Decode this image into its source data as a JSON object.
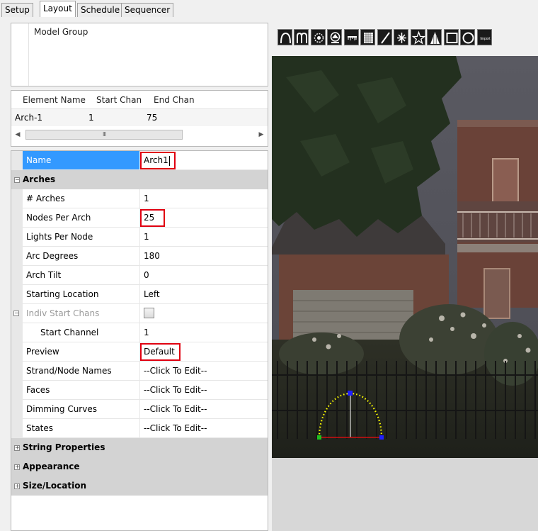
{
  "tabs": [
    {
      "label": "Setup",
      "active": false
    },
    {
      "label": "Layout",
      "active": true
    },
    {
      "label": "Schedule",
      "active": false
    },
    {
      "label": "Sequencer",
      "active": false
    }
  ],
  "model_group": {
    "header": "Model Group"
  },
  "elements": {
    "columns": [
      "Element Name",
      "Start Chan",
      "End Chan"
    ],
    "rows": [
      {
        "name": "Arch-1",
        "start": "1",
        "end": "75"
      }
    ],
    "scroll_grip": "III"
  },
  "properties": {
    "name": {
      "label": "Name",
      "value": "Arch1"
    },
    "arches_category": "Arches",
    "num_arches": {
      "label": "# Arches",
      "value": "1"
    },
    "nodes_per_arch": {
      "label": "Nodes Per Arch",
      "value": "25"
    },
    "lights_per_node": {
      "label": "Lights Per Node",
      "value": "1"
    },
    "arc_degrees": {
      "label": "Arc Degrees",
      "value": "180"
    },
    "arch_tilt": {
      "label": "Arch Tilt",
      "value": "0"
    },
    "starting_location": {
      "label": "Starting Location",
      "value": "Left"
    },
    "indiv_start_chans": {
      "label": "Indiv Start Chans",
      "checked": false
    },
    "start_channel": {
      "label": "Start Channel",
      "value": "1"
    },
    "preview": {
      "label": "Preview",
      "value": "Default"
    },
    "strand_node_names": {
      "label": "Strand/Node Names",
      "value": "--Click To Edit--"
    },
    "faces": {
      "label": "Faces",
      "value": "--Click To Edit--"
    },
    "dimming_curves": {
      "label": "Dimming Curves",
      "value": "--Click To Edit--"
    },
    "states": {
      "label": "States",
      "value": "--Click To Edit--"
    },
    "string_properties_category": "String Properties",
    "appearance_category": "Appearance",
    "size_location_category": "Size/Location"
  },
  "toolbar": {
    "tools": [
      "arch-icon",
      "candy-cane-icon",
      "circle-spinner-icon",
      "tree-icon",
      "icicles-icon",
      "matrix-icon",
      "single-line-icon",
      "star-burst-icon",
      "star-icon",
      "wreath-icon",
      "rectangle-icon",
      "circle-icon",
      "import-icon"
    ],
    "import_label": "Import"
  },
  "colors": {
    "selection": "#3399ff",
    "highlight": "#e00010",
    "arch_nodes": "#ffff00",
    "arch_handle": "#2020ff",
    "arch_start": "#20c020"
  }
}
